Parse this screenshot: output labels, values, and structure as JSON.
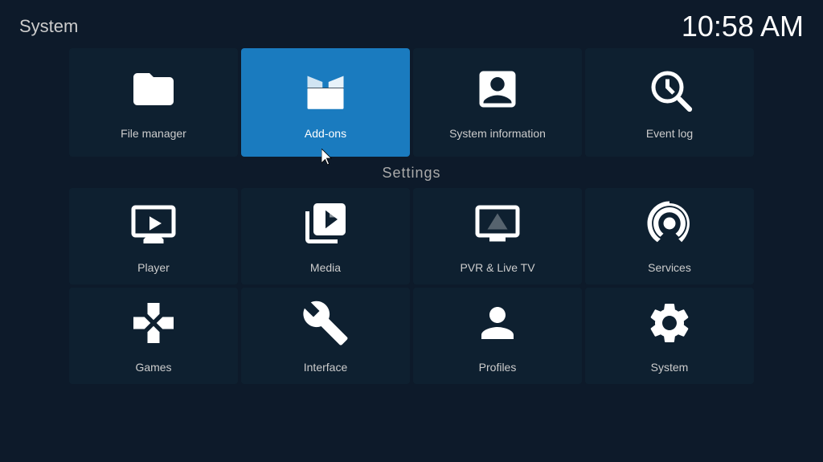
{
  "header": {
    "title": "System",
    "time": "10:58 AM"
  },
  "topTiles": [
    {
      "id": "file-manager",
      "label": "File manager",
      "icon": "folder"
    },
    {
      "id": "add-ons",
      "label": "Add-ons",
      "icon": "box",
      "active": true
    },
    {
      "id": "system-information",
      "label": "System information",
      "icon": "presentation"
    },
    {
      "id": "event-log",
      "label": "Event log",
      "icon": "clock-search"
    }
  ],
  "settingsLabel": "Settings",
  "settingsRow1": [
    {
      "id": "player",
      "label": "Player",
      "icon": "monitor-play"
    },
    {
      "id": "media",
      "label": "Media",
      "icon": "media"
    },
    {
      "id": "pvr-live-tv",
      "label": "PVR & Live TV",
      "icon": "tv"
    },
    {
      "id": "services",
      "label": "Services",
      "icon": "podcast"
    }
  ],
  "settingsRow2": [
    {
      "id": "games",
      "label": "Games",
      "icon": "gamepad"
    },
    {
      "id": "interface",
      "label": "Interface",
      "icon": "wrench-pencil"
    },
    {
      "id": "profiles",
      "label": "Profiles",
      "icon": "person"
    },
    {
      "id": "system",
      "label": "System",
      "icon": "gear-wrench"
    }
  ]
}
